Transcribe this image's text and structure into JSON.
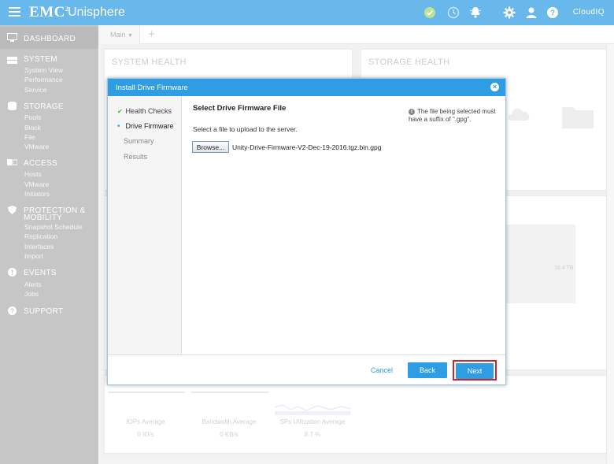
{
  "app": {
    "brand": "EMC",
    "brand_sup": "2",
    "name": "Unisphere",
    "cloudiq": "CloudIQ"
  },
  "topbar_icons": [
    "check-circle-icon",
    "clock-icon",
    "bell-icon",
    "gear-icon",
    "user-icon",
    "help-icon"
  ],
  "sidebar": {
    "dashboard": "DASHBOARD",
    "system": {
      "label": "SYSTEM",
      "items": [
        "System View",
        "Performance",
        "Service"
      ]
    },
    "storage": {
      "label": "STORAGE",
      "items": [
        "Pools",
        "Block",
        "File",
        "VMware"
      ]
    },
    "access": {
      "label": "ACCESS",
      "items": [
        "Hosts",
        "VMware",
        "Initiators"
      ]
    },
    "protection": {
      "label_line1": "PROTECTION &",
      "label_line2": "MOBILITY",
      "items": [
        "Snapshot Schedule",
        "Replication",
        "Interfaces",
        "Import"
      ]
    },
    "events": {
      "label": "EVENTS",
      "items": [
        "Alerts",
        "Jobs"
      ]
    },
    "support": {
      "label": "SUPPORT"
    }
  },
  "tabs": {
    "main": "Main",
    "add": "+"
  },
  "panels": {
    "system_health": "SYSTEM HEALTH",
    "storage_health": "STORAGE HEALTH",
    "capacity_value": "16.4 TB",
    "iops": {
      "label": "IOPs Average",
      "value": "0 IO/s"
    },
    "bandwidth": {
      "label": "Bandwidth Average",
      "value": "0 KB/s"
    },
    "sp_util": {
      "label": "SPs Utilization Average",
      "value": "8.7 %"
    }
  },
  "dialog": {
    "title": "Install Drive Firmware",
    "steps": [
      {
        "label": "Health Checks",
        "state": "done"
      },
      {
        "label": "Drive Firmware",
        "state": "active"
      },
      {
        "label": "Summary",
        "state": "pending"
      },
      {
        "label": "Results",
        "state": "pending"
      }
    ],
    "heading": "Select Drive Firmware File",
    "info_text": "The file being selected must have a suffix of \".gpg\".",
    "instruction": "Select a file to upload to the server.",
    "browse_label": "Browse...",
    "file_name": "Unity-Drive-Firmware-V2-Dec-19-2016.tgz.bin.gpg",
    "cancel_label": "Cancel",
    "back_label": "Back",
    "next_label": "Next"
  },
  "colors": {
    "accent": "#2e9de4",
    "sidebar": "#b1b1b1",
    "highlight": "#c8262d",
    "success": "#4caf50"
  }
}
